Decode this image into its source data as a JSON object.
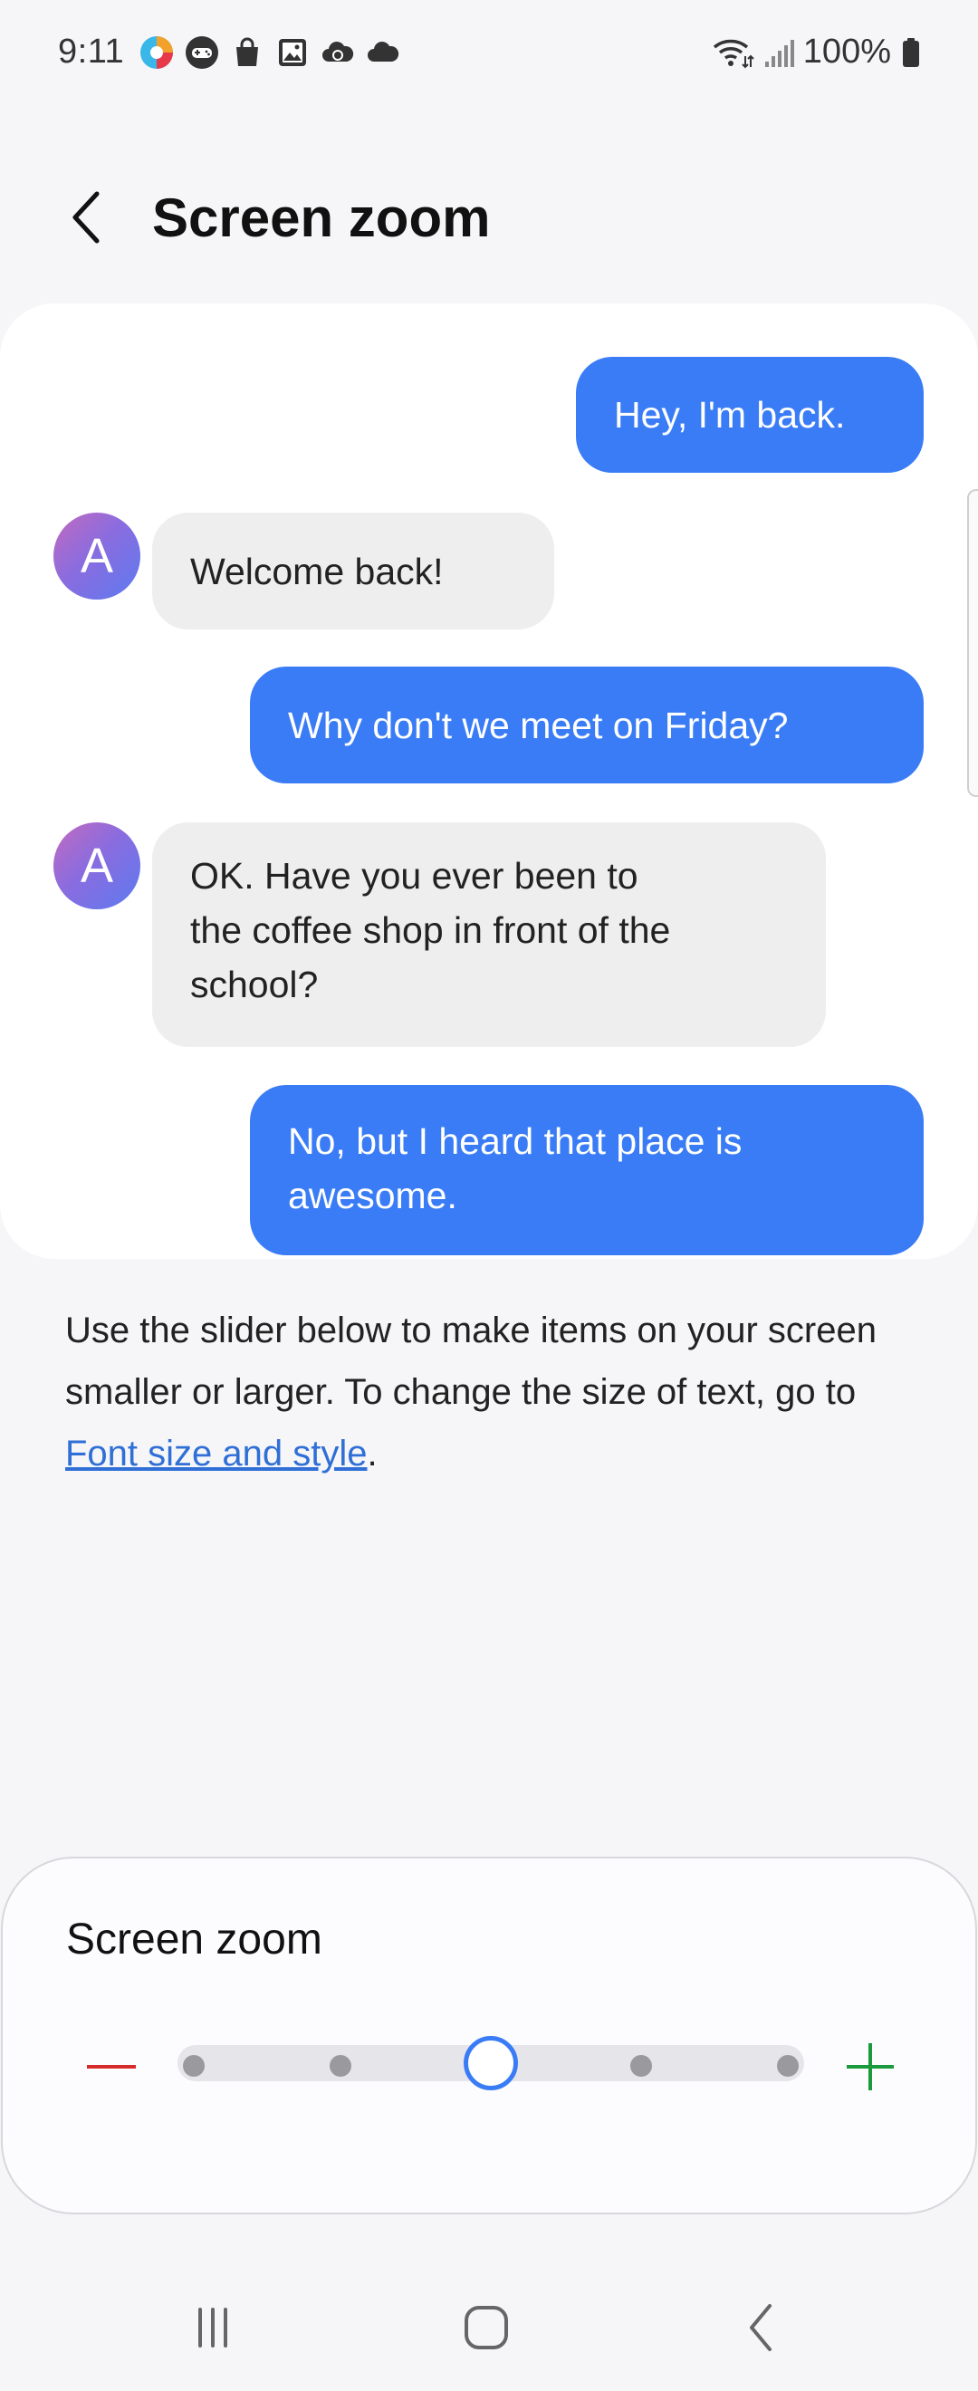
{
  "status_bar": {
    "time": "9:11",
    "battery": "100%",
    "left_icons": [
      "browser-app-icon",
      "game-controller-icon",
      "shopping-bag-icon",
      "gallery-icon",
      "cloud-sync-icon",
      "cloud-icon"
    ],
    "right_icons": [
      "wifi-icon",
      "signal-icon",
      "battery-icon"
    ]
  },
  "header": {
    "title": "Screen zoom"
  },
  "preview": {
    "messages": [
      {
        "direction": "out",
        "text": "Hey, I'm back."
      },
      {
        "direction": "in",
        "avatar": "A",
        "text": "Welcome back!"
      },
      {
        "direction": "out",
        "text": "Why don't we meet on Friday?"
      },
      {
        "direction": "in",
        "avatar": "A",
        "lines": [
          "OK. Have you ever been to",
          "the coffee shop in front of the",
          "school?"
        ]
      },
      {
        "direction": "out",
        "lines": [
          "No, but I heard that place is",
          "awesome."
        ]
      }
    ]
  },
  "description": {
    "text_before_link": "Use the slider below to make items on your screen smaller or larger. To change the size of text, go to ",
    "link_text": "Font size and style",
    "text_after_link": "."
  },
  "zoom_control": {
    "title": "Screen zoom",
    "steps": 5,
    "current_step": 3
  },
  "nav_bar": {
    "buttons": [
      "recent-apps",
      "home",
      "back"
    ]
  },
  "colors": {
    "accent": "#3a7cf6",
    "minus": "#d62b2b",
    "plus": "#1a9a3c",
    "link": "#2f6fd6"
  }
}
